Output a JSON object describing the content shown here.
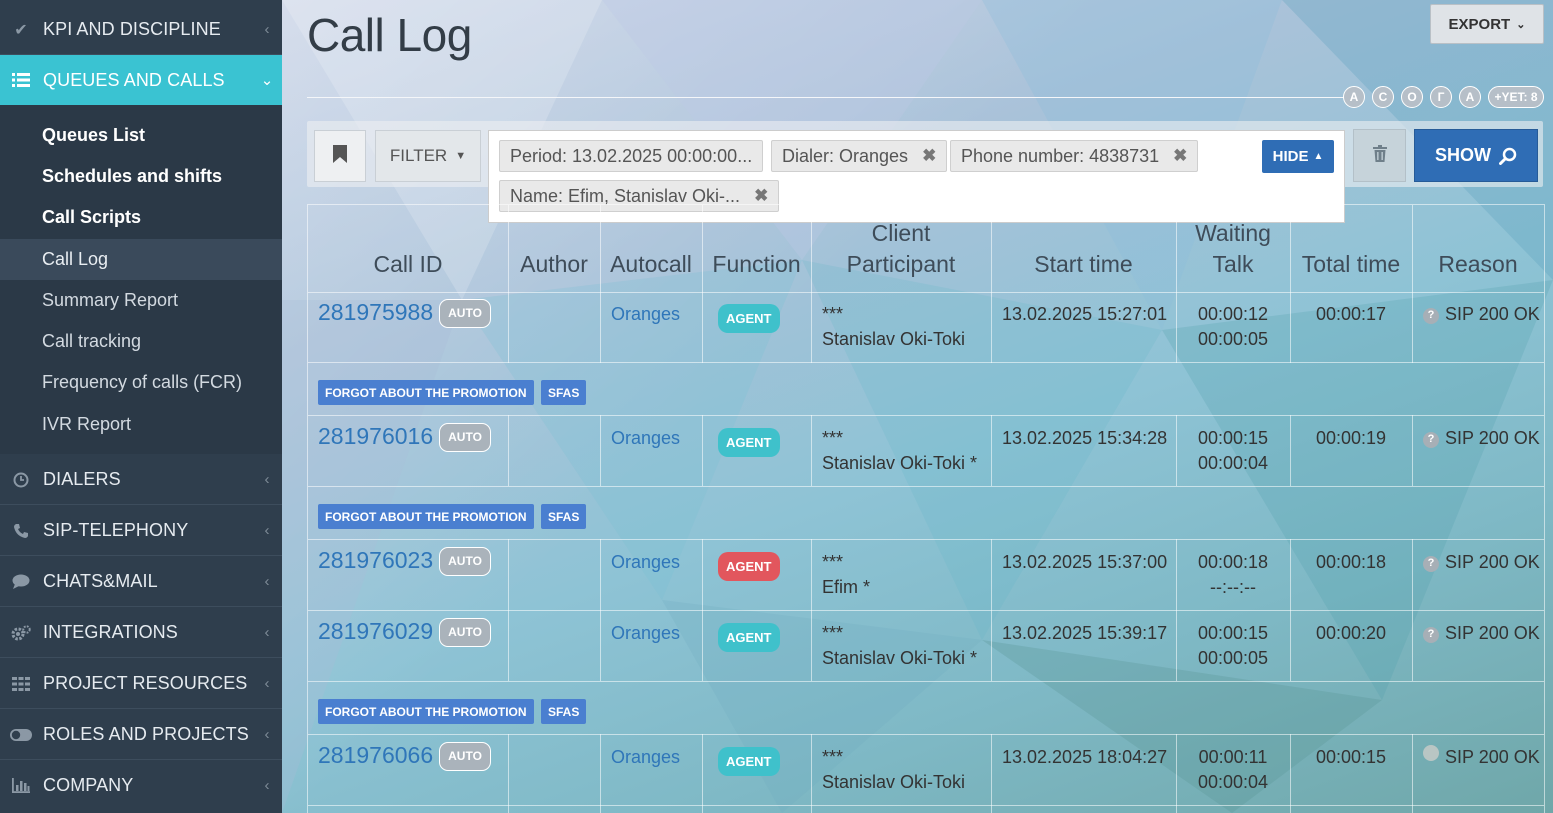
{
  "sidebar": {
    "top_items": [
      {
        "label": "KPI AND DISCIPLINE",
        "icon": "check-icon"
      },
      {
        "label": "QUEUES AND CALLS",
        "icon": "list-icon",
        "active": true
      }
    ],
    "sub_items": [
      {
        "label": "Queues List"
      },
      {
        "label": "Schedules and shifts"
      },
      {
        "label": "Call Scripts"
      },
      {
        "label": "Call Log"
      },
      {
        "label": "Summary Report"
      },
      {
        "label": "Call tracking"
      },
      {
        "label": "Frequency of calls (FCR)"
      },
      {
        "label": "IVR Report"
      }
    ],
    "bottom_items": [
      {
        "label": "DIALERS",
        "icon": "clock-icon"
      },
      {
        "label": "SIP-TELEPHONY",
        "icon": "phone-icon"
      },
      {
        "label": "CHATS&MAIL",
        "icon": "chat-icon"
      },
      {
        "label": "INTEGRATIONS",
        "icon": "gears-icon"
      },
      {
        "label": "PROJECT RESOURCES",
        "icon": "grid-icon"
      },
      {
        "label": "ROLES AND PROJECTS",
        "icon": "toggle-icon"
      },
      {
        "label": "COMPANY",
        "icon": "bar-chart-icon"
      }
    ]
  },
  "header": {
    "title": "Call Log",
    "export_label": "EXPORT",
    "letters": [
      "А",
      "С",
      "О",
      "Г",
      "А"
    ],
    "yet_label": "+YET: 8"
  },
  "filter": {
    "filter_label": "FILTER",
    "chips": [
      "Period: 13.02.2025 00:00:00...",
      "Dialer: Oranges",
      "Phone number: 4838731",
      "Name: Efim, Stanislav Oki-..."
    ],
    "hide_label": "HIDE",
    "show_label": "SHOW"
  },
  "table": {
    "headers": {
      "call_id": "Call ID",
      "author": "Author",
      "autocall": "Autocall",
      "function": "Function",
      "client_1": "Client",
      "client_2": "Participant",
      "start_time": "Start time",
      "waiting_1": "Waiting",
      "waiting_2": "Talk",
      "total_time": "Total time",
      "reason": "Reason"
    },
    "auto_label": "AUTO",
    "tags": {
      "promo": "FORGOT ABOUT THE PROMOTION",
      "sfas": "SFAS"
    },
    "rows": [
      {
        "id": "281975988",
        "dialer": "Oranges",
        "function": "AGENT",
        "client": "***",
        "participant": "Stanislav Oki-Toki",
        "start": "13.02.2025 15:27:01",
        "waiting": "00:00:12",
        "talk": "00:00:05",
        "total": "00:00:17",
        "reason": "SIP 200 OK"
      },
      {
        "id": "281976016",
        "dialer": "Oranges",
        "function": "AGENT",
        "client": "***",
        "participant": "Stanislav Oki-Toki *",
        "start": "13.02.2025 15:34:28",
        "waiting": "00:00:15",
        "talk": "00:00:04",
        "total": "00:00:19",
        "reason": "SIP 200 OK"
      },
      {
        "id": "281976023",
        "dialer": "Oranges",
        "function": "AGENT",
        "client": "***",
        "participant": "Efim *",
        "start": "13.02.2025 15:37:00",
        "waiting": "00:00:18",
        "talk": "--:--:--",
        "total": "00:00:18",
        "reason": "SIP 200 OK"
      },
      {
        "id": "281976029",
        "dialer": "Oranges",
        "function": "AGENT",
        "client": "***",
        "participant": "Stanislav Oki-Toki *",
        "start": "13.02.2025 15:39:17",
        "waiting": "00:00:15",
        "talk": "00:00:05",
        "total": "00:00:20",
        "reason": "SIP 200 OK"
      },
      {
        "id": "281976066",
        "dialer": "Oranges",
        "function": "AGENT",
        "client": "***",
        "participant": "Stanislav Oki-Toki",
        "start": "13.02.2025 18:04:27",
        "waiting": "00:00:11",
        "talk": "00:00:04",
        "total": "00:00:15",
        "reason": "SIP 200 OK"
      }
    ]
  },
  "colors": {
    "sidebar_bg": "#2f3e4d",
    "active_item": "#3ac3d2",
    "primary_button": "#2f6db5",
    "agent_badge": "#3fc1cb",
    "agent_badge_alert": "#e2565d",
    "tag_bg": "#4a7fd0",
    "link": "#2f76b9"
  }
}
